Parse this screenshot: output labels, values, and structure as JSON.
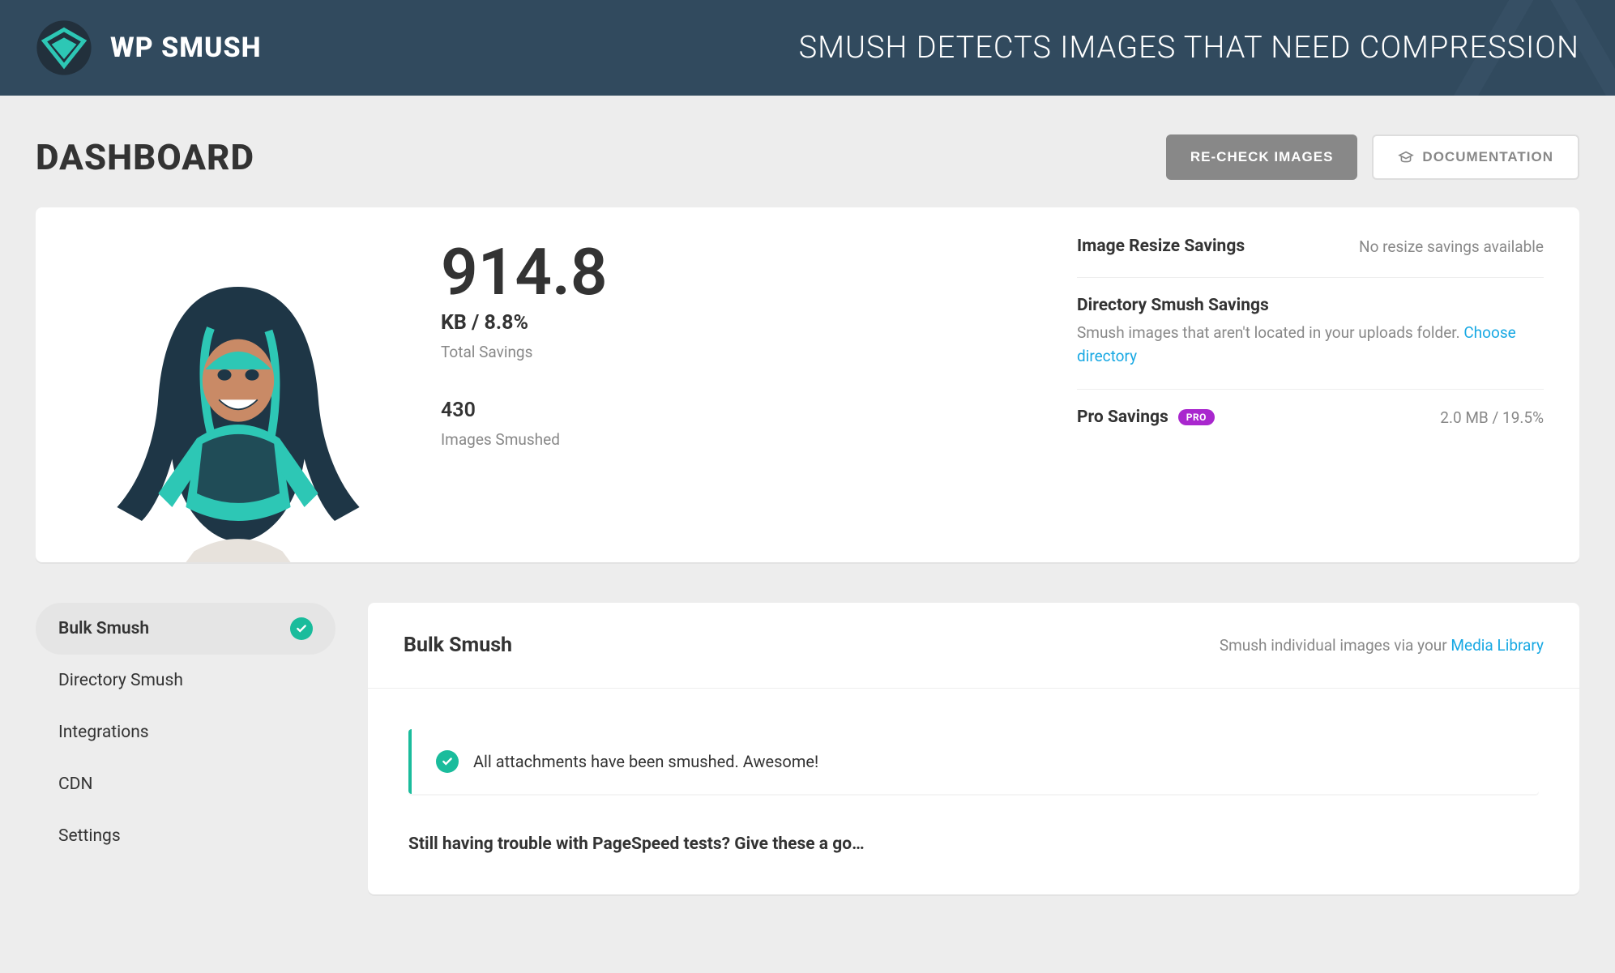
{
  "banner": {
    "brand": "WP SMUSH",
    "headline": "SMUSH DETECTS IMAGES THAT NEED COMPRESSION"
  },
  "header": {
    "title": "DASHBOARD",
    "recheck_label": "RE-CHECK IMAGES",
    "docs_label": "DOCUMENTATION"
  },
  "summary": {
    "total_value": "914.8",
    "total_unit": "KB / 8.8%",
    "total_label": "Total Savings",
    "smushed_value": "430",
    "smushed_label": "Images Smushed",
    "resize": {
      "title": "Image Resize Savings",
      "value": "No resize savings available"
    },
    "directory": {
      "title": "Directory Smush Savings",
      "desc_prefix": "Smush images that aren't located in your uploads folder. ",
      "link": "Choose directory"
    },
    "pro": {
      "title": "Pro Savings",
      "badge": "PRO",
      "value": "2.0 MB / 19.5%"
    }
  },
  "sidebar": {
    "items": [
      {
        "label": "Bulk Smush",
        "active": true,
        "checked": true
      },
      {
        "label": "Directory Smush"
      },
      {
        "label": "Integrations"
      },
      {
        "label": "CDN"
      },
      {
        "label": "Settings"
      }
    ]
  },
  "bulk": {
    "title": "Bulk Smush",
    "hint_prefix": "Smush individual images via your ",
    "hint_link": "Media Library",
    "notice": "All attachments have been smushed. Awesome!",
    "subhead": "Still having trouble with PageSpeed tests? Give these a go…"
  }
}
